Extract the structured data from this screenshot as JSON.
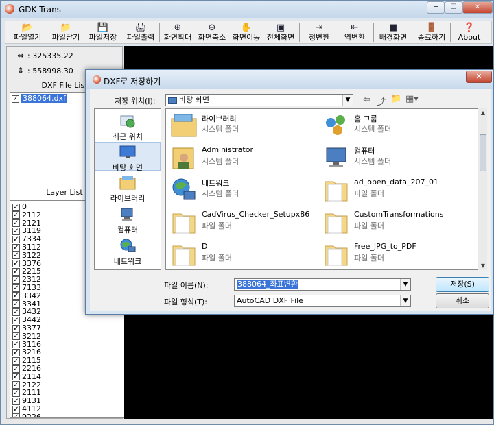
{
  "app": {
    "title": "GDK Trans"
  },
  "window_buttons": {
    "min": "─",
    "max": "☐",
    "close": "✕"
  },
  "toolbar": [
    {
      "label": "파일열기",
      "icon": "open-file-icon"
    },
    {
      "label": "파일닫기",
      "icon": "close-file-icon"
    },
    {
      "label": "파일저장",
      "icon": "save-icon"
    },
    {
      "label": "파일출력",
      "icon": "print-icon"
    },
    {
      "label": "화면확대",
      "icon": "zoom-in-icon"
    },
    {
      "label": "화면축소",
      "icon": "zoom-out-icon"
    },
    {
      "label": "화면이동",
      "icon": "pan-hand-icon"
    },
    {
      "label": "전체화면",
      "icon": "fullscreen-icon"
    },
    {
      "label": "정변환",
      "icon": "forward-transform-icon"
    },
    {
      "label": "역변환",
      "icon": "inverse-transform-icon"
    },
    {
      "label": "배경화면",
      "icon": "background-icon"
    },
    {
      "label": "종료하기",
      "icon": "exit-icon"
    },
    {
      "label": "About",
      "icon": "about-icon"
    }
  ],
  "coords": {
    "x": ": 325335.22",
    "y": ": 558998.30"
  },
  "dxf_file_list": {
    "title": "DXF File List",
    "items": [
      "388064.dxf"
    ]
  },
  "layer_list": {
    "title": "Layer List",
    "items": [
      "0",
      "2112",
      "2121",
      "3119",
      "7334",
      "3112",
      "3122",
      "3376",
      "2215",
      "2312",
      "7133",
      "3342",
      "3341",
      "3432",
      "3442",
      "3377",
      "3212",
      "3116",
      "3216",
      "2115",
      "2216",
      "2114",
      "2122",
      "2111",
      "9131",
      "4112",
      "9226"
    ]
  },
  "dialog": {
    "title": "DXF로 저장하기",
    "save_in_label": "저장 위치(I):",
    "save_in_value": "바탕 화면",
    "places": [
      {
        "label": "최근 위치",
        "icon": "recent-places-icon"
      },
      {
        "label": "바탕 화면",
        "icon": "desktop-icon"
      },
      {
        "label": "라이브러리",
        "icon": "libraries-icon"
      },
      {
        "label": "컴퓨터",
        "icon": "computer-icon"
      },
      {
        "label": "네트워크",
        "icon": "network-icon"
      }
    ],
    "files": [
      {
        "name": "라이브러리",
        "type": "시스템 폴더",
        "icon": "libraries-folder-icon"
      },
      {
        "name": "홈 그룹",
        "type": "시스템 폴더",
        "icon": "homegroup-icon"
      },
      {
        "name": "Administrator",
        "type": "시스템 폴더",
        "icon": "user-folder-icon"
      },
      {
        "name": "컴퓨터",
        "type": "시스템 폴더",
        "icon": "computer-icon"
      },
      {
        "name": "네트워크",
        "type": "시스템 폴더",
        "icon": "network-icon"
      },
      {
        "name": "ad_open_data_207_01",
        "type": "파일 폴더",
        "icon": "folder-icon"
      },
      {
        "name": "CadVirus_Checker_Setupx86",
        "type": "파일 폴더",
        "icon": "folder-icon"
      },
      {
        "name": "CustomTransformations",
        "type": "파일 폴더",
        "icon": "folder-icon"
      },
      {
        "name": "D",
        "type": "파일 폴더",
        "icon": "folder-icon"
      },
      {
        "name": "Free_JPG_to_PDF",
        "type": "파일 폴더",
        "icon": "folder-icon"
      }
    ],
    "filename_label": "파일 이름(N):",
    "filename_value": "388064_좌표변환",
    "filetype_label": "파일 형식(T):",
    "filetype_value": "AutoCAD DXF File",
    "save_button": "저장(S)",
    "cancel_button": "취소"
  }
}
